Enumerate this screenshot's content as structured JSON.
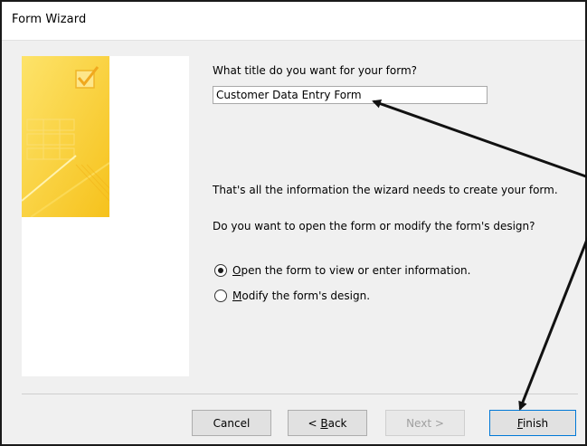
{
  "window": {
    "title": "Form Wizard"
  },
  "prompt": {
    "title_question": "What title do you want for your form?"
  },
  "title_field": {
    "value": "Customer Data Entry Form"
  },
  "messages": {
    "info": "That's all the information the wizard needs to create your form.",
    "question": "Do you want to open the form or modify the form's design?"
  },
  "options": {
    "open": {
      "mnemonic": "O",
      "rest": "pen the form to view or enter information.",
      "selected": true
    },
    "modify": {
      "mnemonic": "M",
      "rest": "odify the form's design.",
      "selected": false
    }
  },
  "buttons": {
    "cancel": "Cancel",
    "back_prefix": "< ",
    "back_mnemonic": "B",
    "back_rest": "ack",
    "next": "Next >",
    "finish_mnemonic": "F",
    "finish_rest": "inish"
  },
  "colors": {
    "accent": "#0078d7",
    "art_yellow": "#f9cc2f",
    "arrow": "#111111"
  }
}
